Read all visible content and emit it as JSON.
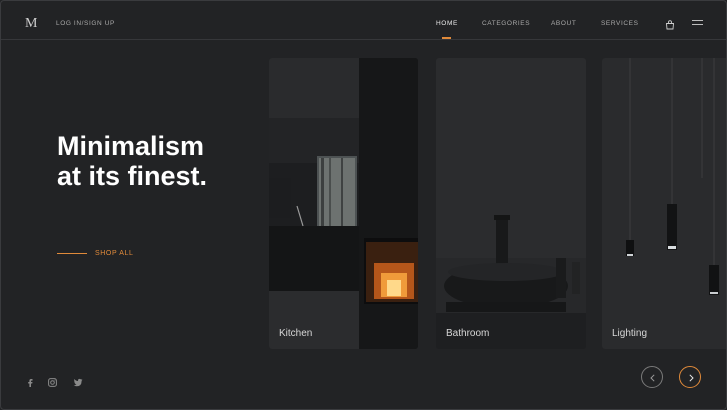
{
  "header": {
    "logo": "M",
    "login_label": "LOG IN/SIGN UP",
    "nav": [
      {
        "label": "HOME",
        "active": true
      },
      {
        "label": "CATEGORIES",
        "active": false
      },
      {
        "label": "ABOUT",
        "active": false
      },
      {
        "label": "SERVICES",
        "active": false
      }
    ],
    "cart_icon": "shopping-bag-icon",
    "menu_icon": "hamburger-menu-icon"
  },
  "hero": {
    "headline_line1": "Minimalism",
    "headline_line2": "at its finest.",
    "cta_label": "SHOP ALL"
  },
  "cards": [
    {
      "label": "Kitchen"
    },
    {
      "label": "Bathroom"
    },
    {
      "label": "Lighting"
    }
  ],
  "social": [
    "facebook-icon",
    "instagram-icon",
    "twitter-icon"
  ],
  "carousel": {
    "prev_icon": "chevron-left-icon",
    "next_icon": "chevron-right-icon"
  },
  "colors": {
    "background": "#222325",
    "accent": "#e08a3a",
    "text": "#ffffff"
  }
}
